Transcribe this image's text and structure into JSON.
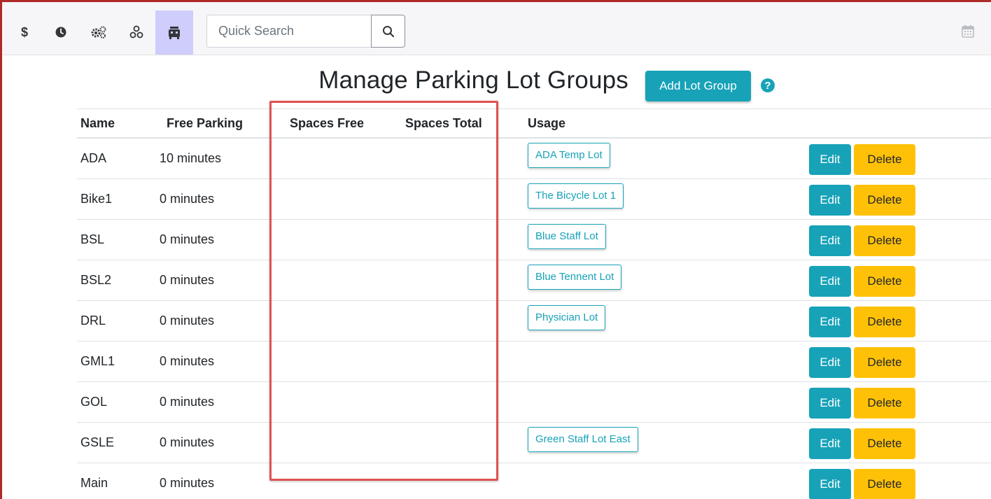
{
  "toolbar": {
    "buttons": [
      {
        "icon": "dollar-icon",
        "active": false
      },
      {
        "icon": "clock-icon",
        "active": false
      },
      {
        "icon": "gears-icon",
        "active": false
      },
      {
        "icon": "nodes-icon",
        "active": false
      },
      {
        "icon": "parking-lot-icon",
        "active": true
      }
    ],
    "search_placeholder": "Quick Search",
    "search_value": "",
    "right_icon": "calendar-icon"
  },
  "page": {
    "title": "Manage Parking Lot Groups",
    "add_button_label": "Add Lot Group",
    "help_icon": "question-circle-icon"
  },
  "table": {
    "headers": [
      "Name",
      "Free Parking",
      "Spaces Free",
      "Spaces Total",
      "Usage"
    ],
    "rows": [
      {
        "name": "ADA",
        "free_parking": "10 minutes",
        "spaces_free": "",
        "spaces_total": "",
        "usage": "ADA Temp Lot"
      },
      {
        "name": "Bike1",
        "free_parking": "0 minutes",
        "spaces_free": "",
        "spaces_total": "",
        "usage": "The Bicycle Lot 1"
      },
      {
        "name": "BSL",
        "free_parking": "0 minutes",
        "spaces_free": "",
        "spaces_total": "",
        "usage": "Blue Staff Lot"
      },
      {
        "name": "BSL2",
        "free_parking": "0 minutes",
        "spaces_free": "",
        "spaces_total": "",
        "usage": "Blue Tennent Lot"
      },
      {
        "name": "DRL",
        "free_parking": "0 minutes",
        "spaces_free": "",
        "spaces_total": "",
        "usage": "Physician Lot"
      },
      {
        "name": "GML1",
        "free_parking": "0 minutes",
        "spaces_free": "",
        "spaces_total": "",
        "usage": ""
      },
      {
        "name": "GOL",
        "free_parking": "0 minutes",
        "spaces_free": "",
        "spaces_total": "",
        "usage": ""
      },
      {
        "name": "GSLE",
        "free_parking": "0 minutes",
        "spaces_free": "",
        "spaces_total": "",
        "usage": "Green Staff Lot East"
      },
      {
        "name": "Main",
        "free_parking": "0 minutes",
        "spaces_free": "",
        "spaces_total": "",
        "usage": ""
      }
    ],
    "edit_label": "Edit",
    "delete_label": "Delete"
  },
  "colors": {
    "accent": "#17a2b8",
    "warning": "#ffc107",
    "active_tab": "#cfcdfb",
    "highlight_border": "#e05252",
    "frame": "#b02a2a"
  }
}
